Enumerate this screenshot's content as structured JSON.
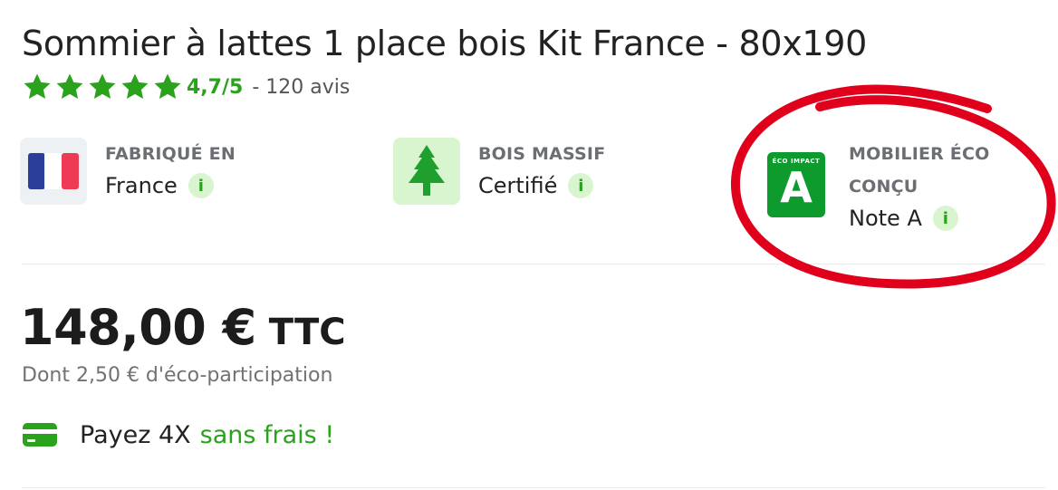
{
  "product": {
    "title": "Sommier à lattes 1 place bois Kit France - 80x190",
    "rating": {
      "score": "4,7/5",
      "count": "- 120 avis",
      "stars": 5,
      "star_color": "#2aa21c"
    }
  },
  "features": [
    {
      "label": "FABRIQUÉ EN",
      "value": "France",
      "icon": "france-flag-icon"
    },
    {
      "label": "BOIS MASSIF",
      "value": "Certifié",
      "icon": "tree-icon"
    },
    {
      "label_line1": "MOBILIER ÉCO",
      "label_line2": "CONÇU",
      "value": "Note A",
      "icon": "eco-impact-badge-icon",
      "badge_top": "ÉCO IMPACT",
      "badge_letter": "A"
    }
  ],
  "info_glyph": "i",
  "price": {
    "amount": "148,00 €",
    "suffix": "TTC",
    "eco_participation": "Dont 2,50 € d'éco-participation"
  },
  "payment": {
    "text": "Payez 4X",
    "highlight": "sans frais !",
    "icon": "credit-card-icon"
  },
  "colors": {
    "accent_green": "#2aa21c",
    "badge_green": "#0e9b2e",
    "annotation_red": "#e1001b"
  }
}
